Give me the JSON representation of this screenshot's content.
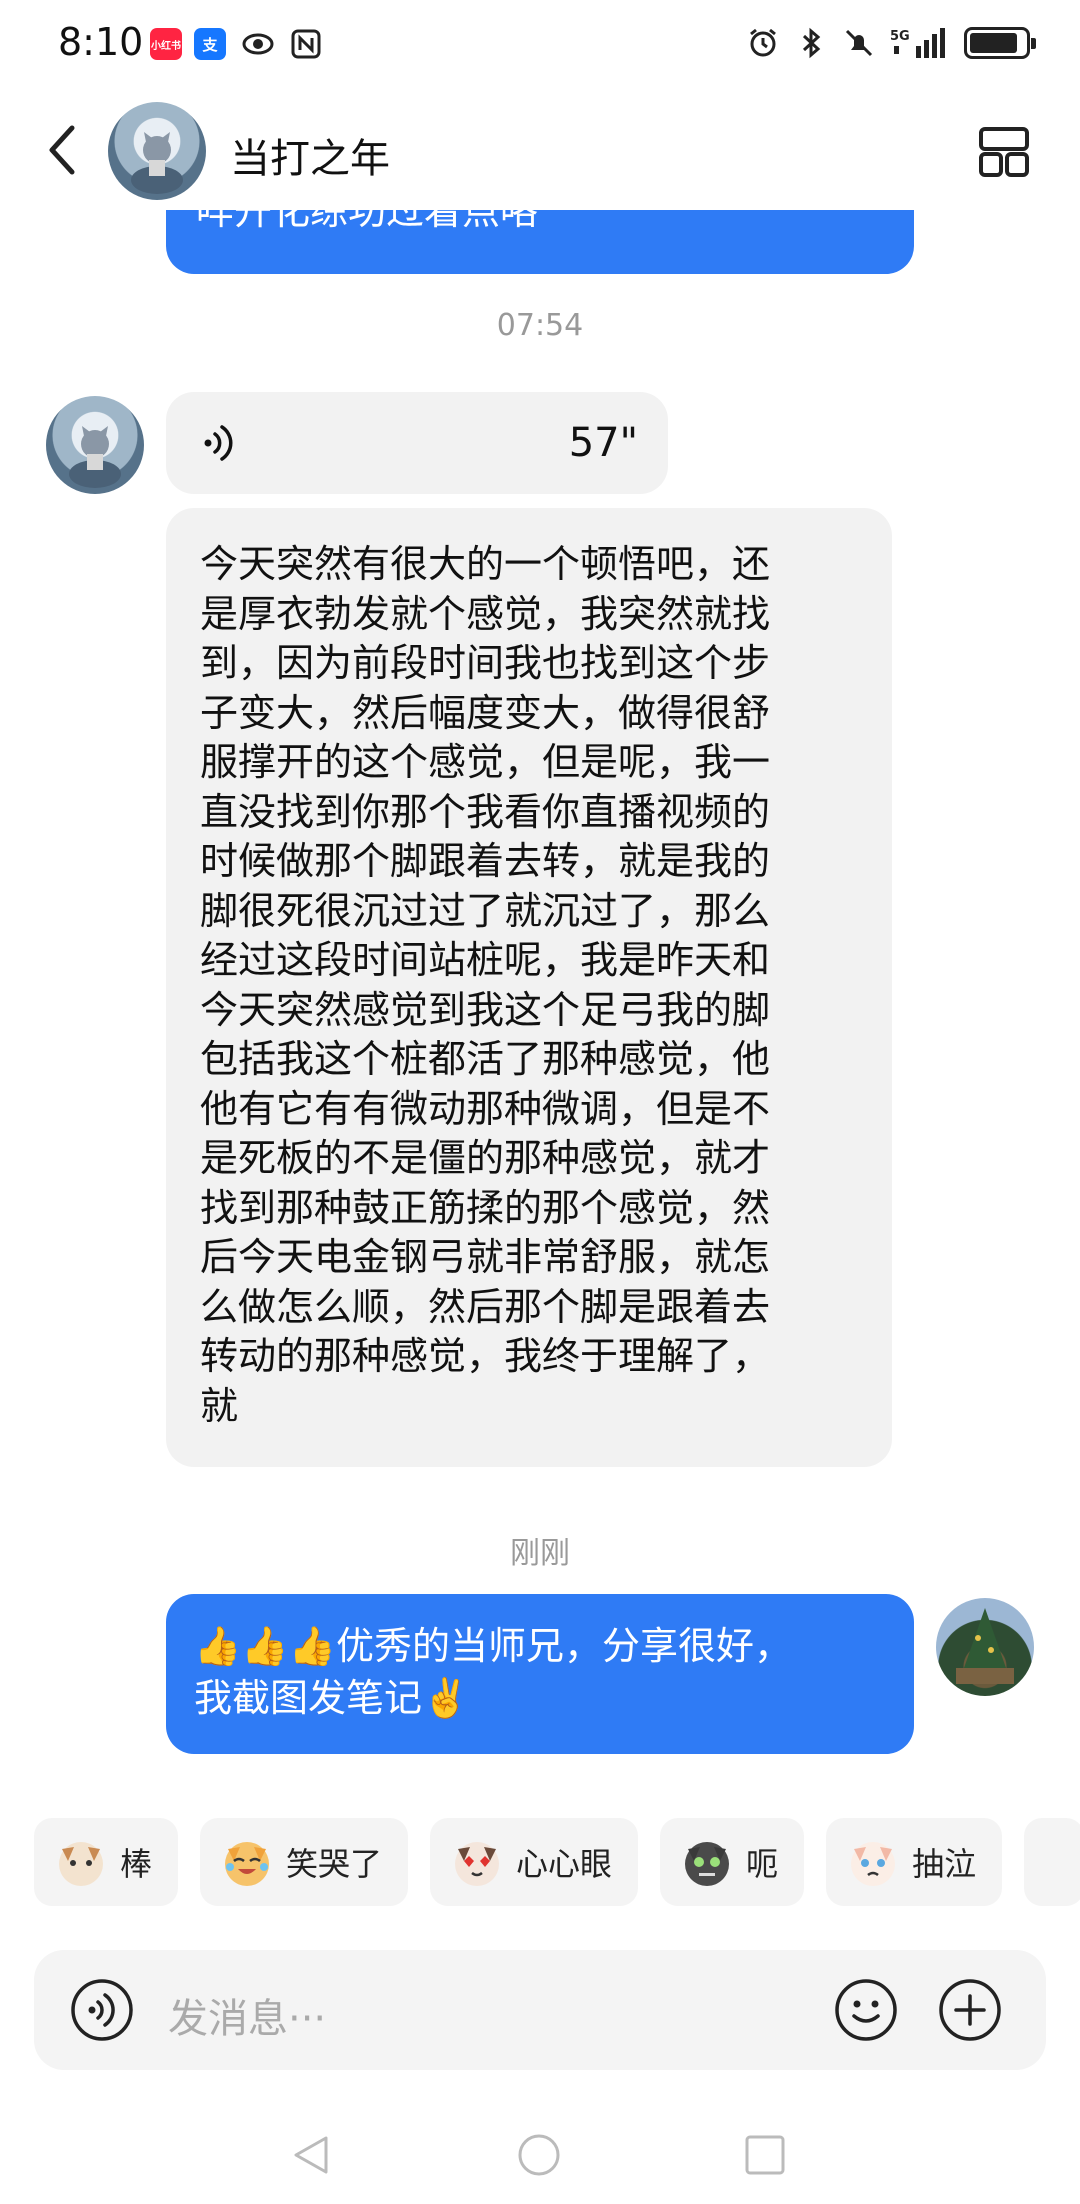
{
  "status_bar": {
    "time": "8:10",
    "app_icons": [
      {
        "name": "xiaohongshu-icon",
        "text": "小红书",
        "color": "#ff2442"
      },
      {
        "name": "alipay-icon",
        "text": "支",
        "color": "#1677ff"
      },
      {
        "name": "eye-icon",
        "text": "",
        "color": "#222222"
      },
      {
        "name": "nfc-icon",
        "text": "",
        "color": "#222222"
      }
    ],
    "network": "5G"
  },
  "header": {
    "title": "当打之年"
  },
  "messages": {
    "partial_sent_text": "咩开化练功过着点咯",
    "divider_1": "07:54",
    "voice_duration": "57\"",
    "long_text": "今天突然有很大的一个顿悟吧，还\n是厚衣勃发就个感觉，我突然就找\n到，因为前段时间我也找到这个步\n子变大，然后幅度变大，做得很舒\n服撑开的这个感觉，但是呢，我一\n直没找到你那个我看你直播视频的\n时候做那个脚跟着去转，就是我的\n脚很死很沉过过了就沉过了，那么\n经过这段时间站桩呢，我是昨天和\n今天突然感觉到我这个足弓我的脚\n包括我这个桩都活了那种感觉，他\n他有它有有微动那种微调，但是不\n是死板的不是僵的那种感觉，就才\n找到那种鼓正筋揉的那个感觉，然\n后今天电金钢弓就非常舒服，就怎\n么做怎么顺，然后那个脚是跟着去\n转动的那种感觉，我终于理解了，\n就",
    "divider_2": "刚刚",
    "sent_text": "👍👍👍优秀的当师兄，分享很好，\n我截图发笔记✌️"
  },
  "quick_replies": [
    {
      "label": "棒",
      "icon": "cat-thumbs-icon",
      "color": "#c98a52"
    },
    {
      "label": "笑哭了",
      "icon": "cat-laugh-cry-icon",
      "color": "#f0a23a"
    },
    {
      "label": "心心眼",
      "icon": "cat-heart-eyes-icon",
      "color": "#e0633f"
    },
    {
      "label": "呃",
      "icon": "cat-awkward-icon",
      "color": "#3a3a3a"
    },
    {
      "label": "抽泣",
      "icon": "cat-sob-icon",
      "color": "#f2b9a6"
    }
  ],
  "input": {
    "placeholder": "发消息···"
  },
  "colors": {
    "sent_bubble": "#2f7bf5",
    "received_bubble": "#f2f2f2"
  }
}
